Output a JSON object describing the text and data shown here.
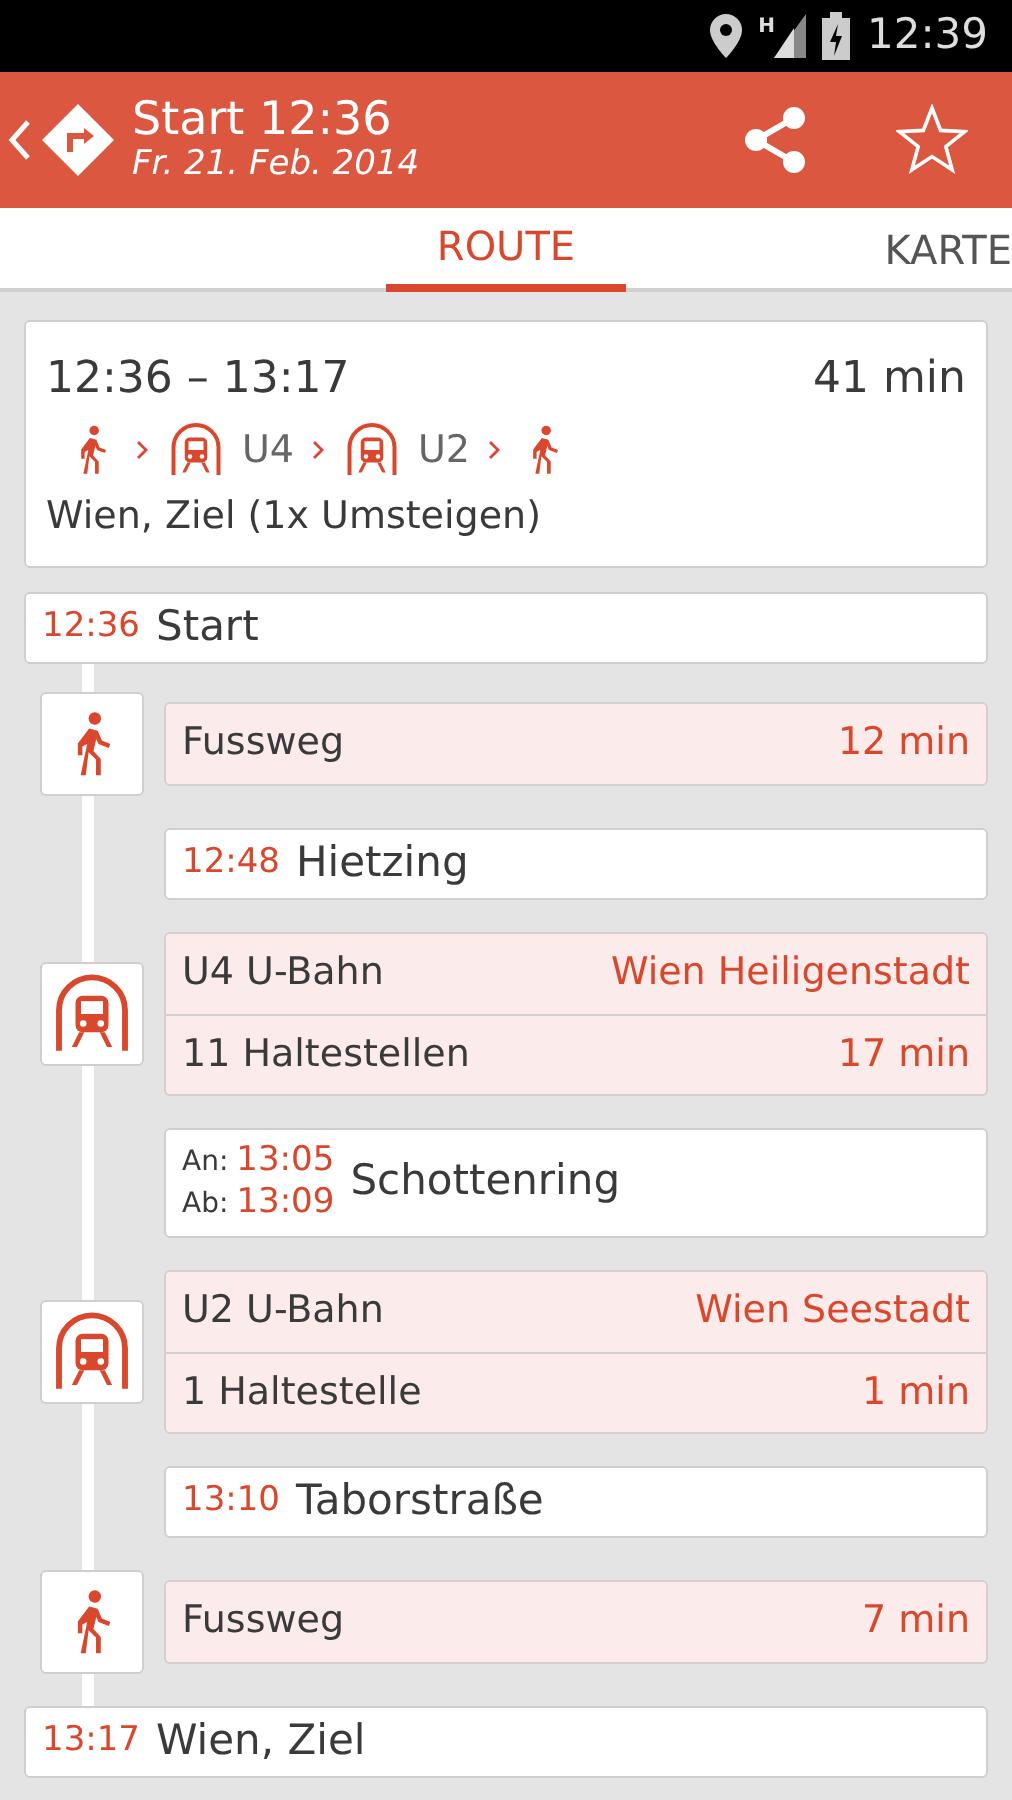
{
  "status_bar": {
    "network_type": "H",
    "time": "12:39"
  },
  "header": {
    "title": "Start 12:36",
    "date": "Fr. 21. Feb. 2014"
  },
  "tabs": [
    {
      "label": "ROUTE",
      "selected": true
    },
    {
      "label": "KARTE",
      "selected": false
    }
  ],
  "summary": {
    "times": "12:36 – 13:17",
    "duration": "41 min",
    "segments": [
      {
        "kind": "walk"
      },
      {
        "kind": "subway",
        "line": "U4"
      },
      {
        "kind": "subway",
        "line": "U2"
      },
      {
        "kind": "walk"
      }
    ],
    "destination": "Wien, Ziel (1x Umsteigen)"
  },
  "itinerary": [
    {
      "kind": "endpoint",
      "time": "12:36",
      "name": "Start"
    },
    {
      "kind": "walk",
      "rows": [
        {
          "left": "Fussweg",
          "right": "12 min"
        }
      ]
    },
    {
      "kind": "stop",
      "time": "12:48",
      "name": "Hietzing"
    },
    {
      "kind": "subway",
      "rows": [
        {
          "left": "U4 U-Bahn",
          "right": "Wien Heiligenstadt"
        },
        {
          "left": "11 Haltestellen",
          "right": "17 min"
        }
      ]
    },
    {
      "kind": "transfer",
      "arrival_label": "An:",
      "arrival": "13:05",
      "departure_label": "Ab:",
      "departure": "13:09",
      "name": "Schottenring"
    },
    {
      "kind": "subway",
      "rows": [
        {
          "left": "U2 U-Bahn",
          "right": "Wien Seestadt"
        },
        {
          "left": "1 Haltestelle",
          "right": "1 min"
        }
      ]
    },
    {
      "kind": "stop",
      "time": "13:10",
      "name": "Taborstraße"
    },
    {
      "kind": "walk",
      "rows": [
        {
          "left": "Fussweg",
          "right": "7 min"
        }
      ]
    },
    {
      "kind": "endpoint",
      "time": "13:17",
      "name": "Wien, Ziel"
    }
  ]
}
